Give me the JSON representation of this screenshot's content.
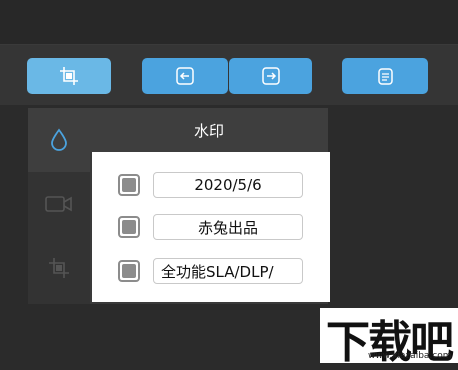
{
  "icons": {
    "toolbar": [
      "crop-icon",
      "import-icon",
      "export-icon",
      "document-icon"
    ],
    "tabs": [
      "droplet-icon",
      "camera-icon",
      "crop-icon"
    ]
  },
  "panel": {
    "title": "水印"
  },
  "watermark": {
    "rows": [
      {
        "text": "2020/5/6",
        "checked": true
      },
      {
        "text": "赤兔出品",
        "checked": true
      },
      {
        "text": "全功能SLA/DLP/",
        "checked": true
      }
    ]
  },
  "logo": {
    "text": "下载吧",
    "url": "www.xiazaiba.com"
  },
  "colors": {
    "accent": "#4ba3df",
    "accent_active": "#6ab8e6",
    "background": "#2b2b2b"
  }
}
